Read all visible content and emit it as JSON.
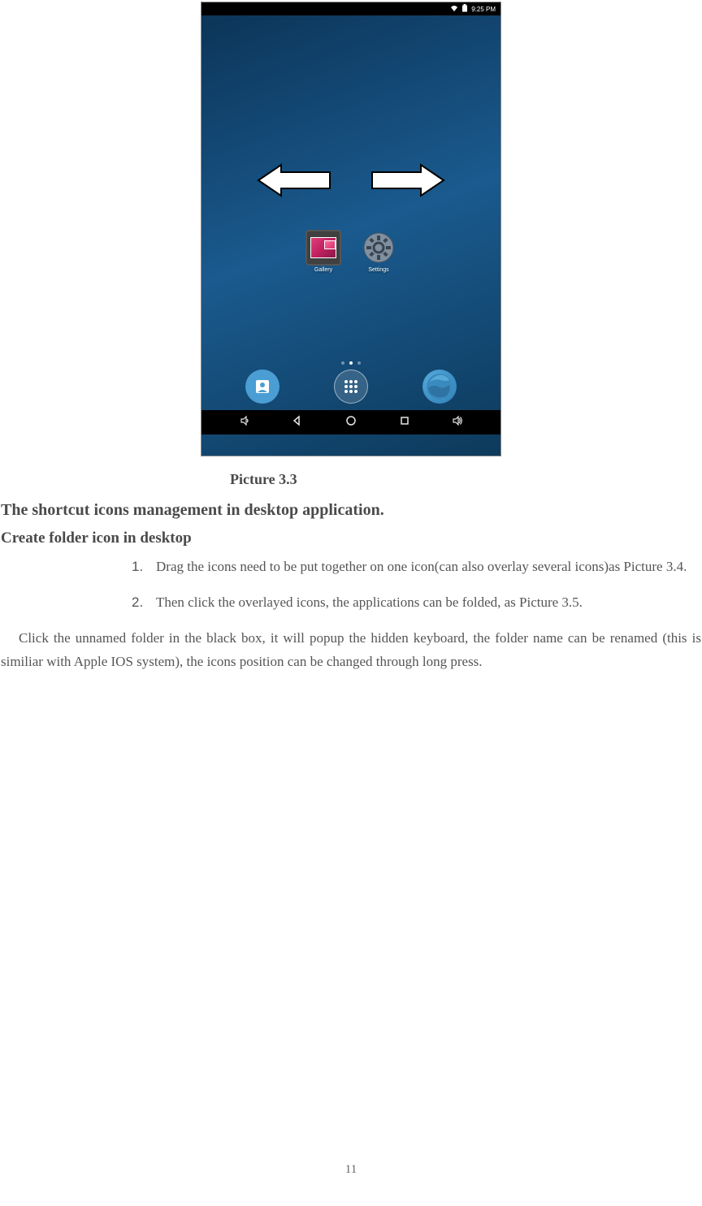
{
  "screenshot": {
    "status_bar": {
      "time": "9:25 PM"
    },
    "apps": {
      "gallery": {
        "label": "Gallery"
      },
      "settings": {
        "label": "Settings"
      }
    }
  },
  "caption": "Picture 3.3",
  "heading1": "The shortcut icons management in desktop application.",
  "heading2": "Create folder icon in desktop",
  "list": {
    "item1_num": "1.",
    "item1_text": "Drag the icons need to be put together on one icon(can also overlay several icons)as Picture 3.4.",
    "item2_num": "2.",
    "item2_text": "Then click the overlayed icons, the applications can be folded, as Picture 3.5."
  },
  "body": "Click the unnamed folder in the black box, it will popup the hidden keyboard, the folder name can be renamed (this is similiar with Apple IOS system), the icons position can be changed through long press.",
  "page_number": "11"
}
